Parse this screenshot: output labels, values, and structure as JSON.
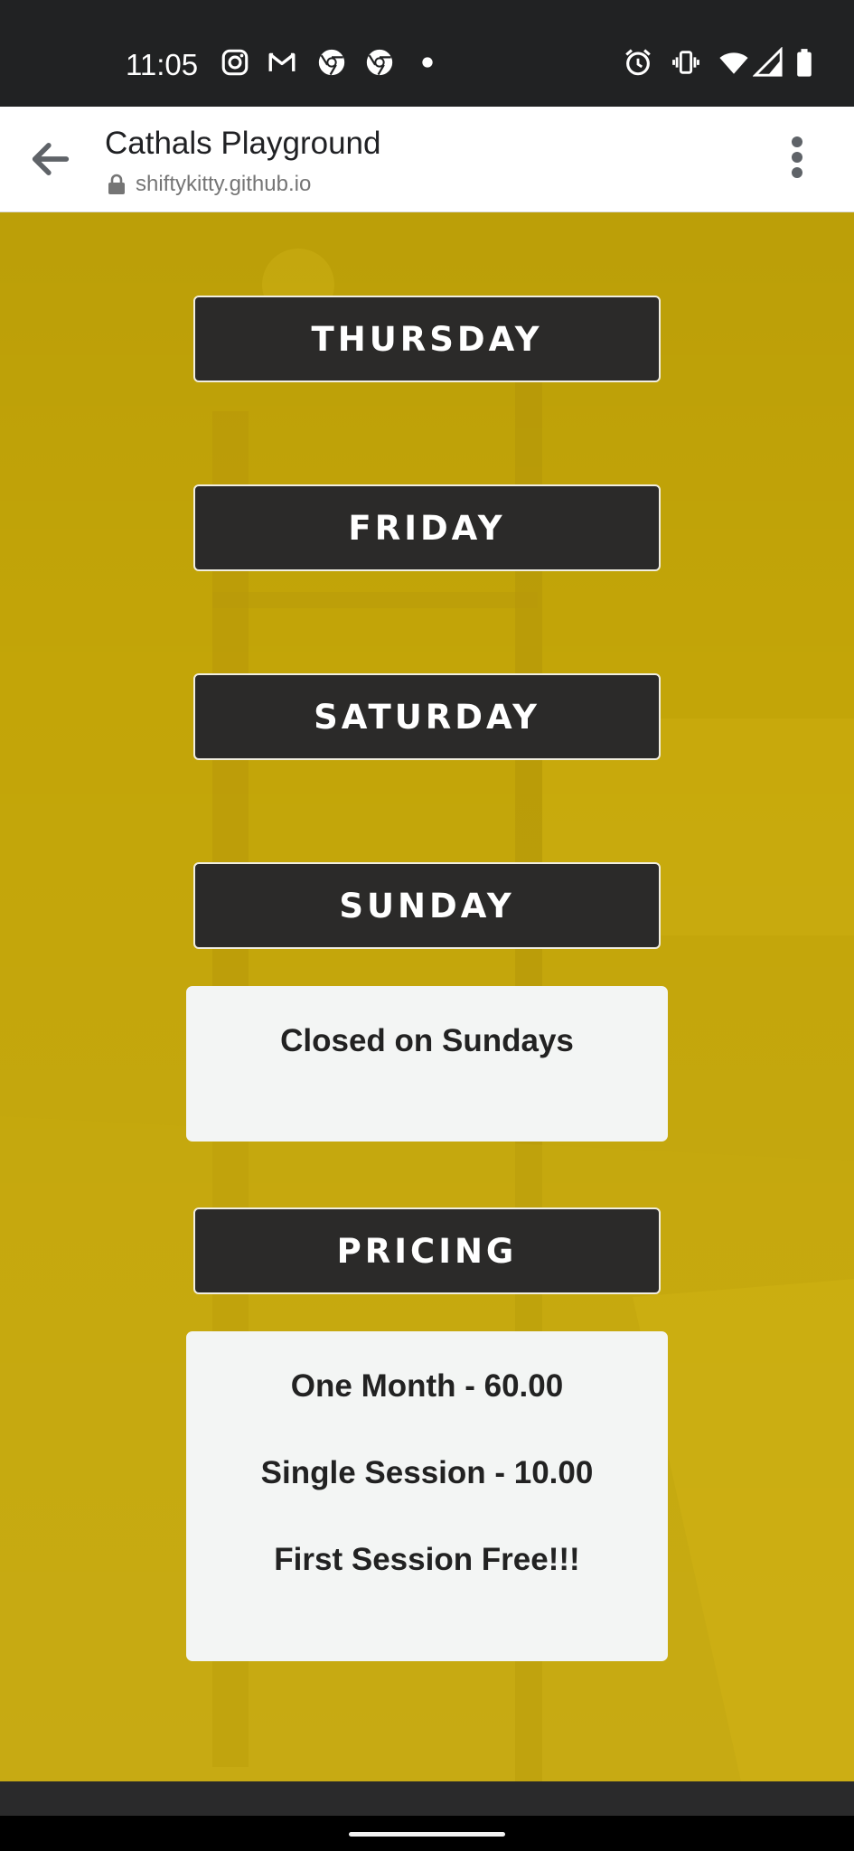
{
  "status_bar": {
    "time": "11:05",
    "left_icons": [
      "instagram-icon",
      "gmail-icon",
      "chrome-icon",
      "chrome-icon",
      "dot-icon"
    ],
    "right_icons": [
      "alarm-icon",
      "vibrate-icon",
      "wifi-icon",
      "signal-icon",
      "battery-icon"
    ]
  },
  "toolbar": {
    "title": "Cathals Playground",
    "url": "shiftykitty.github.io",
    "back_icon": "arrow-left-icon",
    "menu_icon": "more-vert-icon"
  },
  "sections": {
    "thursday": "THURSDAY",
    "friday": "FRIDAY",
    "saturday": "SATURDAY",
    "sunday": "SUNDAY",
    "pricing": "PRICING"
  },
  "sunday_card": {
    "text": "Closed on Sundays"
  },
  "pricing_card": {
    "lines": [
      "One Month - 60.00",
      "Single Session - 10.00",
      "First Session Free!!!"
    ]
  },
  "colors": {
    "background": "#c3a508",
    "heading_button": "#2b2a29",
    "card": "#f3f5f4",
    "status_bar": "#212223"
  }
}
